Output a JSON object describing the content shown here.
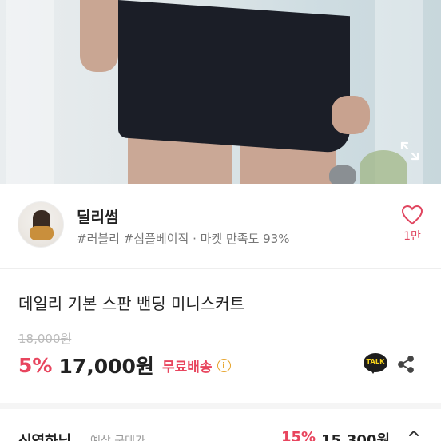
{
  "hero": {
    "expand_icon": "expand-icon"
  },
  "seller": {
    "name": "딜리썸",
    "tags": "#러블리 #심플베이직 · 마켓 만족도 93%",
    "like_count": "1만",
    "like_icon": "heart-outline-icon",
    "like_color": "#e0455f"
  },
  "product": {
    "title": "데일리 기본 스판 밴딩 미니스커트",
    "original_price": "18,000원",
    "discount": "5%",
    "price": "17,000원",
    "free_shipping": "무료배송",
    "info_icon_glyph": "i",
    "talk_label": "TALK",
    "share_icon": "share-icon"
  },
  "bottom": {
    "title": "신영하님",
    "subtitle": "예상 구매가",
    "discount": "15%",
    "price": "15,300원",
    "chevron_icon": "chevron-down-icon"
  },
  "colors": {
    "accent": "#e8455e",
    "info": "#e6a42c",
    "kakao_yellow": "#f5d21d"
  }
}
